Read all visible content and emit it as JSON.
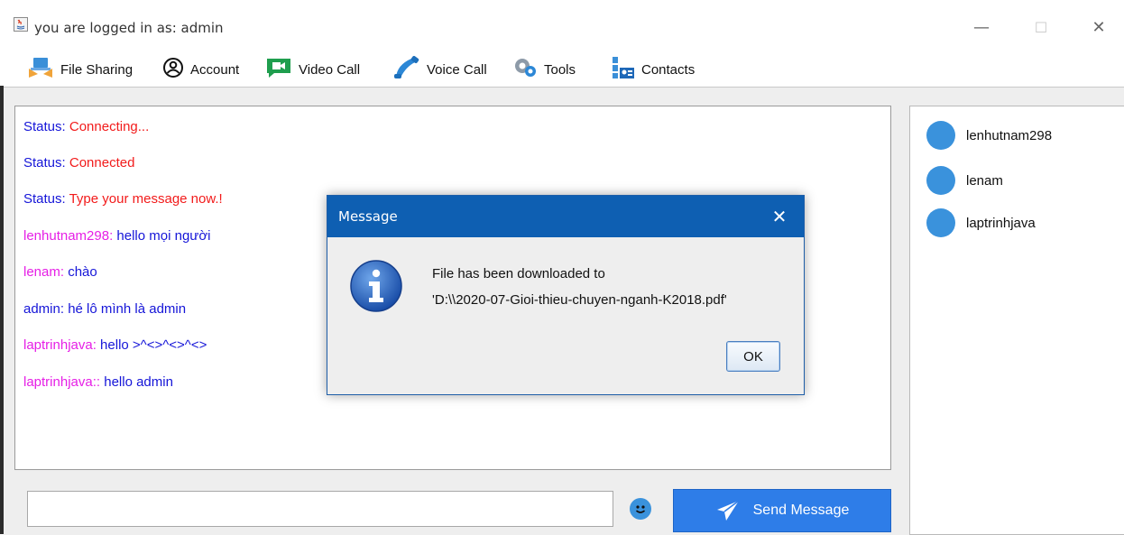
{
  "window": {
    "title": "you are logged in as: admin",
    "minimize": "—",
    "maximize": "☐",
    "close": "✕"
  },
  "menu": [
    {
      "label": "File Sharing",
      "icon": "file-sharing-icon"
    },
    {
      "label": "Account",
      "icon": "account-icon"
    },
    {
      "label": "Video Call",
      "icon": "video-call-icon"
    },
    {
      "label": "Voice Call",
      "icon": "voice-call-icon"
    },
    {
      "label": "Tools",
      "icon": "tools-icon"
    },
    {
      "label": "Contacts",
      "icon": "contacts-icon"
    }
  ],
  "chat": {
    "messages": [
      {
        "who": "Status:",
        "text": " Connecting...",
        "who_color": "blue",
        "text_color": "red"
      },
      {
        "who": "Status:",
        "text": " Connected",
        "who_color": "blue",
        "text_color": "red"
      },
      {
        "who": "Status:",
        "text": " Type your message now.!",
        "who_color": "blue",
        "text_color": "red"
      },
      {
        "who": "lenhutnam298:",
        "text": " hello mọi người",
        "who_color": "pink",
        "text_color": "blue"
      },
      {
        "who": "lenam:",
        "text": " chào",
        "who_color": "pink",
        "text_color": "blue"
      },
      {
        "who": "admin:",
        "text": " hé lô mình là admin",
        "who_color": "blue",
        "text_color": "blue"
      },
      {
        "who": "laptrinhjava:",
        "text": " hello >^<>^<>^<>",
        "who_color": "pink",
        "text_color": "blue"
      },
      {
        "who": "laptrinhjava::",
        "text": " hello admin",
        "who_color": "pink",
        "text_color": "blue"
      }
    ]
  },
  "users": [
    {
      "name": "lenhutnam298"
    },
    {
      "name": "lenam"
    },
    {
      "name": "laptrinhjava"
    }
  ],
  "composer": {
    "input_value": "",
    "send_label": "Send Message"
  },
  "dialog": {
    "title": "Message",
    "line1": "File has been downloaded to",
    "line2": "'D:\\\\2020-07-Gioi-thieu-chuyen-nganh-K2018.pdf'",
    "ok_label": "OK"
  },
  "colors": {
    "accent": "#2e7de8",
    "dialog_title": "#0e5fb2",
    "user_dot": "#3a92dc",
    "status_red": "#f21b1b",
    "name_pink": "#e61fe6",
    "name_blue": "#1515d8"
  }
}
